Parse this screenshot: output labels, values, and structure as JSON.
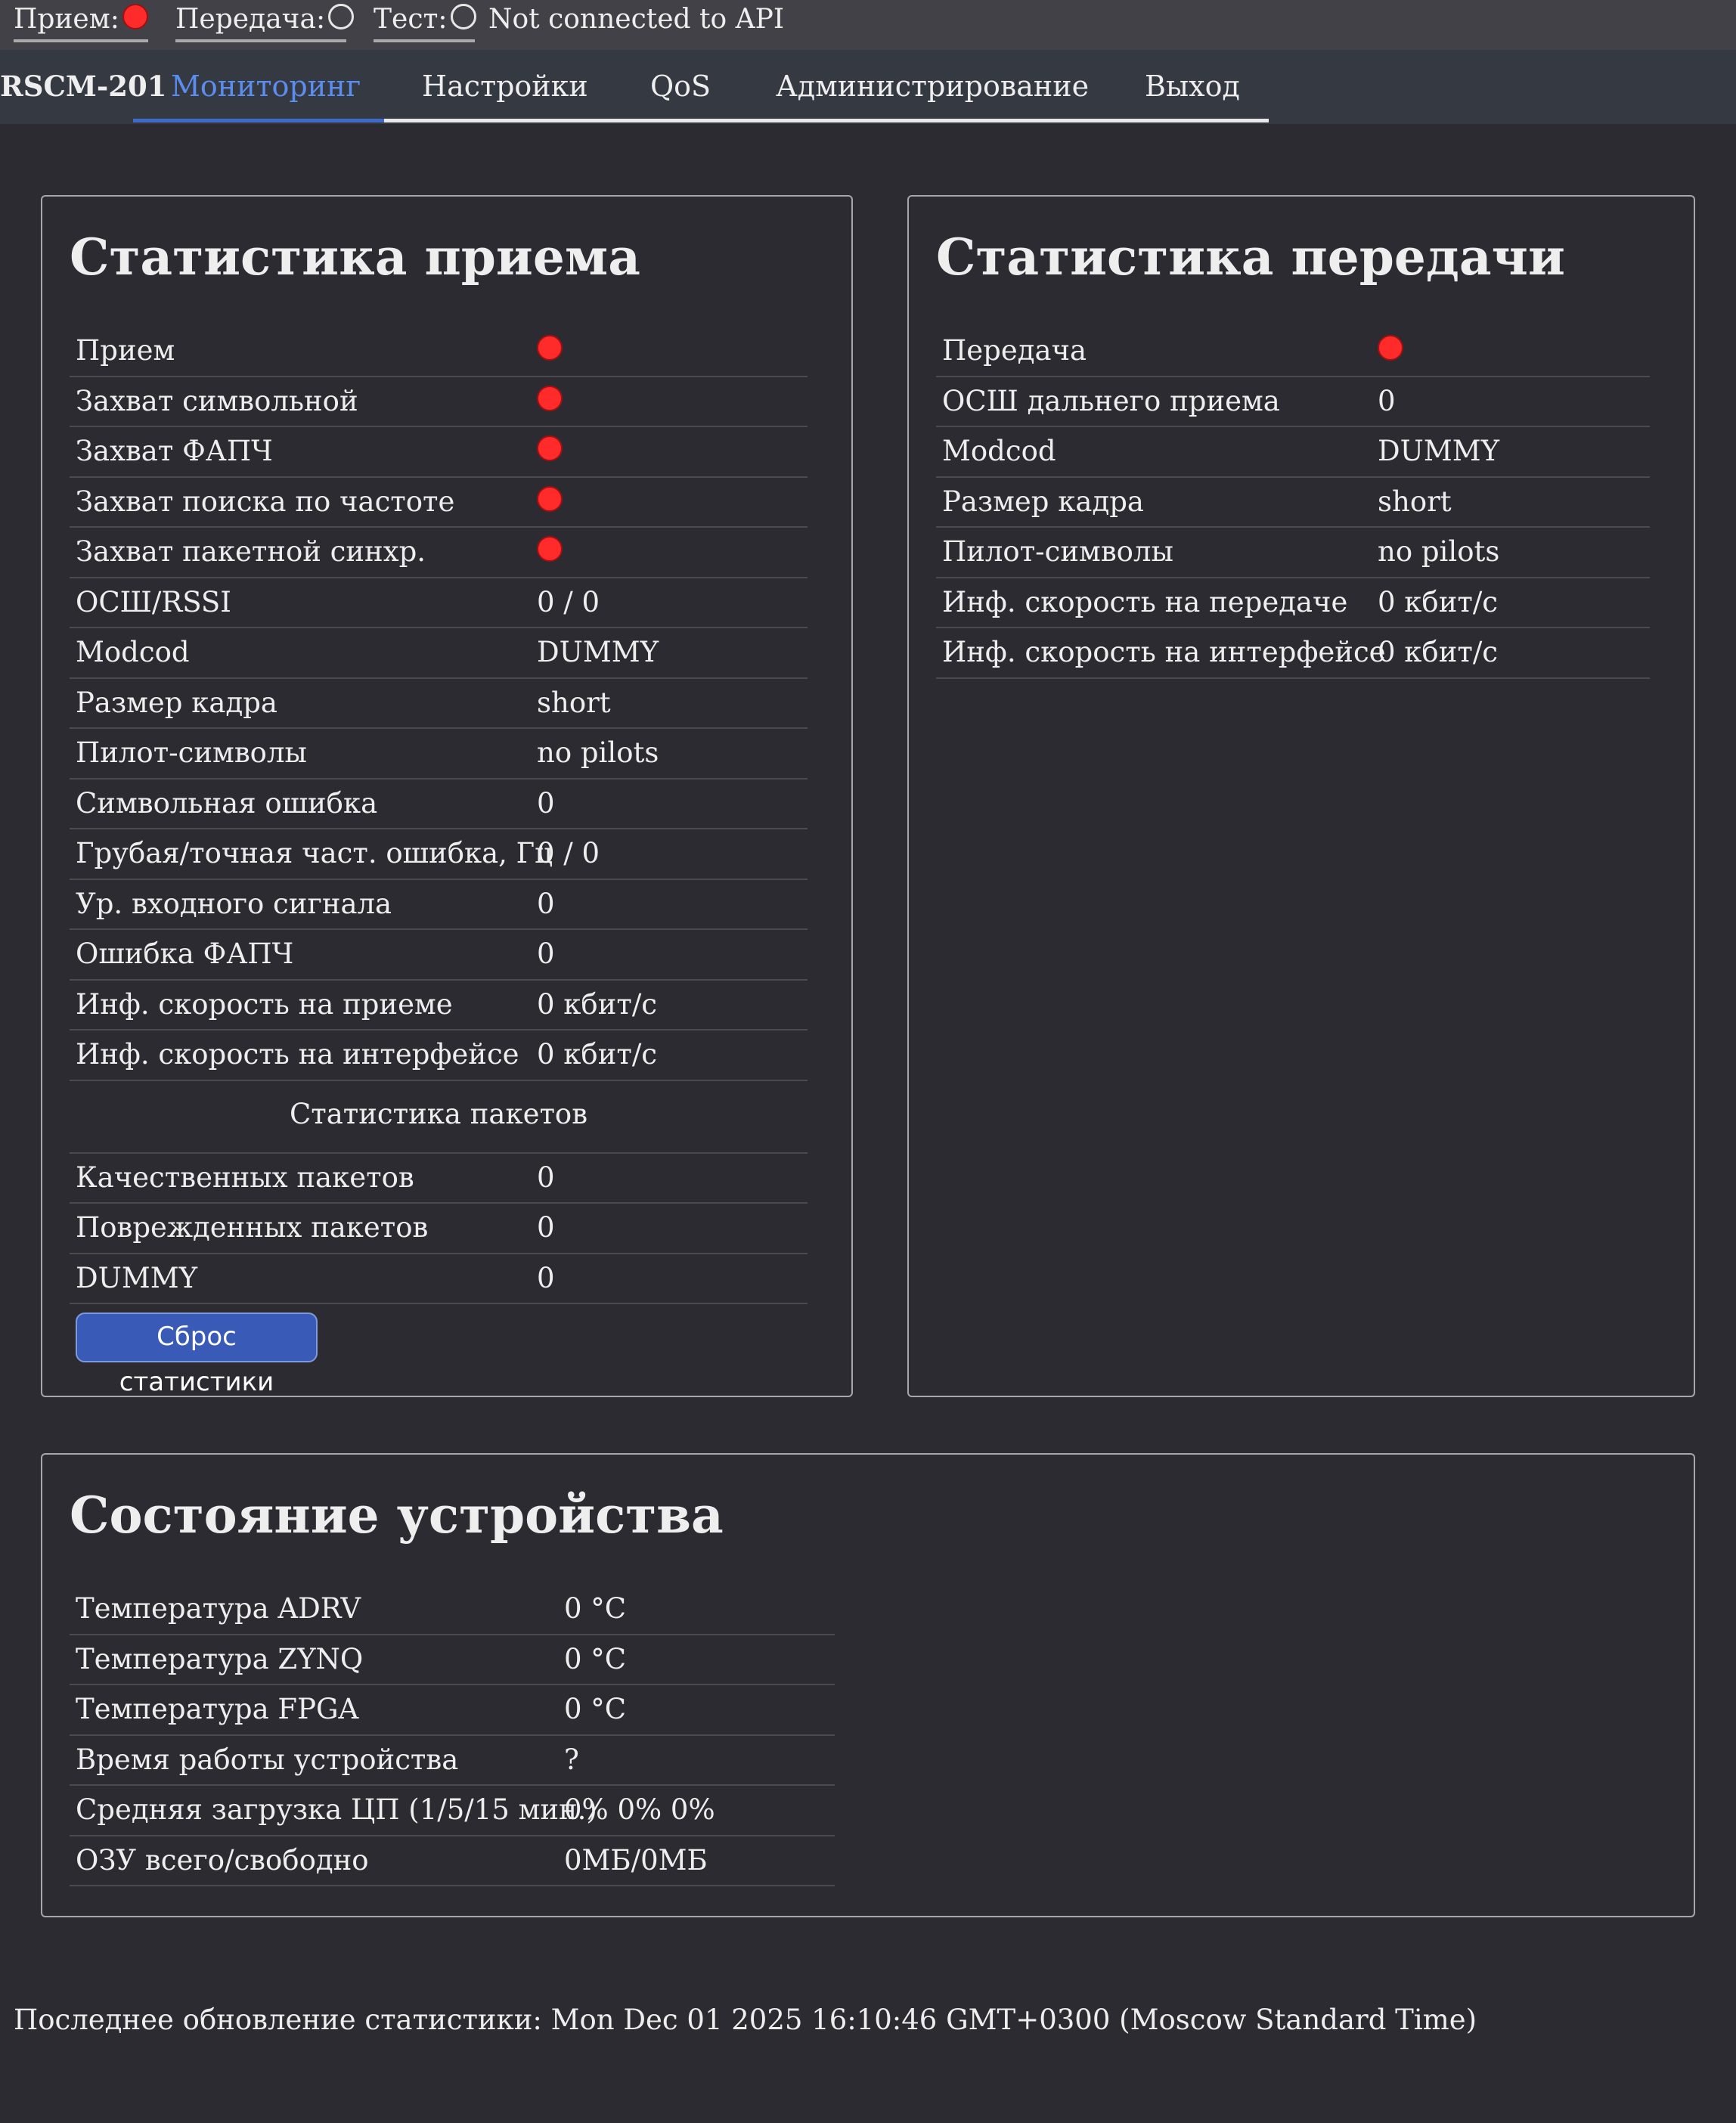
{
  "status": {
    "rx_label": "Прием:",
    "tx_label": "Передача:",
    "test_label": "Тест:",
    "api_status": "Not connected to API",
    "rx_indicator": "red",
    "tx_indicator": "off",
    "test_indicator": "off"
  },
  "nav": {
    "brand": "RSCM-201",
    "tabs": [
      "Мониторинг",
      "Настройки",
      "QoS",
      "Администрирование",
      "Выход"
    ],
    "active": "Мониторинг"
  },
  "rx": {
    "title": "Статистика приема",
    "rows": [
      {
        "label": "Прием",
        "indicator": "red"
      },
      {
        "label": "Захват символьной",
        "indicator": "red"
      },
      {
        "label": "Захват ФАПЧ",
        "indicator": "red"
      },
      {
        "label": "Захват поиска по частоте",
        "indicator": "red"
      },
      {
        "label": "Захват пакетной синхр.",
        "indicator": "red"
      },
      {
        "label": "ОСШ/RSSI",
        "value": "0 / 0"
      },
      {
        "label": "Modcod",
        "value": "DUMMY"
      },
      {
        "label": "Размер кадра",
        "value": "short"
      },
      {
        "label": "Пилот-символы",
        "value": "no pilots"
      },
      {
        "label": "Символьная ошибка",
        "value": "0"
      },
      {
        "label": "Грубая/точная част. ошибка, Гц",
        "value": "0 / 0"
      },
      {
        "label": "Ур. входного сигнала",
        "value": "0"
      },
      {
        "label": "Ошибка ФАПЧ",
        "value": "0"
      },
      {
        "label": "Инф. скорость на приеме",
        "value": "0 кбит/с"
      },
      {
        "label": "Инф. скорость на интерфейсе",
        "value": "0 кбит/с"
      }
    ],
    "packets_header": "Статистика пакетов",
    "packet_rows": [
      {
        "label": "Качественных пакетов",
        "value": "0"
      },
      {
        "label": "Поврежденных пакетов",
        "value": "0"
      },
      {
        "label": "DUMMY",
        "value": "0"
      }
    ],
    "reset_button": "Сброс статистики"
  },
  "tx": {
    "title": "Статистика передачи",
    "rows": [
      {
        "label": "Передача",
        "indicator": "red"
      },
      {
        "label": "ОСШ дальнего приема",
        "value": "0"
      },
      {
        "label": "Modcod",
        "value": "DUMMY"
      },
      {
        "label": "Размер кадра",
        "value": "short"
      },
      {
        "label": "Пилот-символы",
        "value": "no pilots"
      },
      {
        "label": "Инф. скорость на передаче",
        "value": "0 кбит/с"
      },
      {
        "label": "Инф. скорость на интерфейсе",
        "value": "0 кбит/с"
      }
    ]
  },
  "device": {
    "title": "Состояние устройства",
    "rows": [
      {
        "label": "Температура ADRV",
        "value": "0 °C"
      },
      {
        "label": "Температура ZYNQ",
        "value": "0 °C"
      },
      {
        "label": "Температура FPGA",
        "value": "0 °C"
      },
      {
        "label": "Время работы устройства",
        "value": "?"
      },
      {
        "label": "Средняя загрузка ЦП (1/5/15 мин.)",
        "value": "0% 0% 0%"
      },
      {
        "label": "ОЗУ всего/свободно",
        "value": "0МБ/0МБ"
      }
    ]
  },
  "footer": {
    "last_update": "Последнее обновление статистики: Mon Dec 01 2025 16:10:46 GMT+0300 (Moscow Standard Time)"
  },
  "colors": {
    "background": "#2c2b31",
    "status_bar": "#424147",
    "nav_bar": "#353942",
    "accent": "#5b8def",
    "indicator_red": "#ff2a2a",
    "button": "#3a5ab7"
  }
}
